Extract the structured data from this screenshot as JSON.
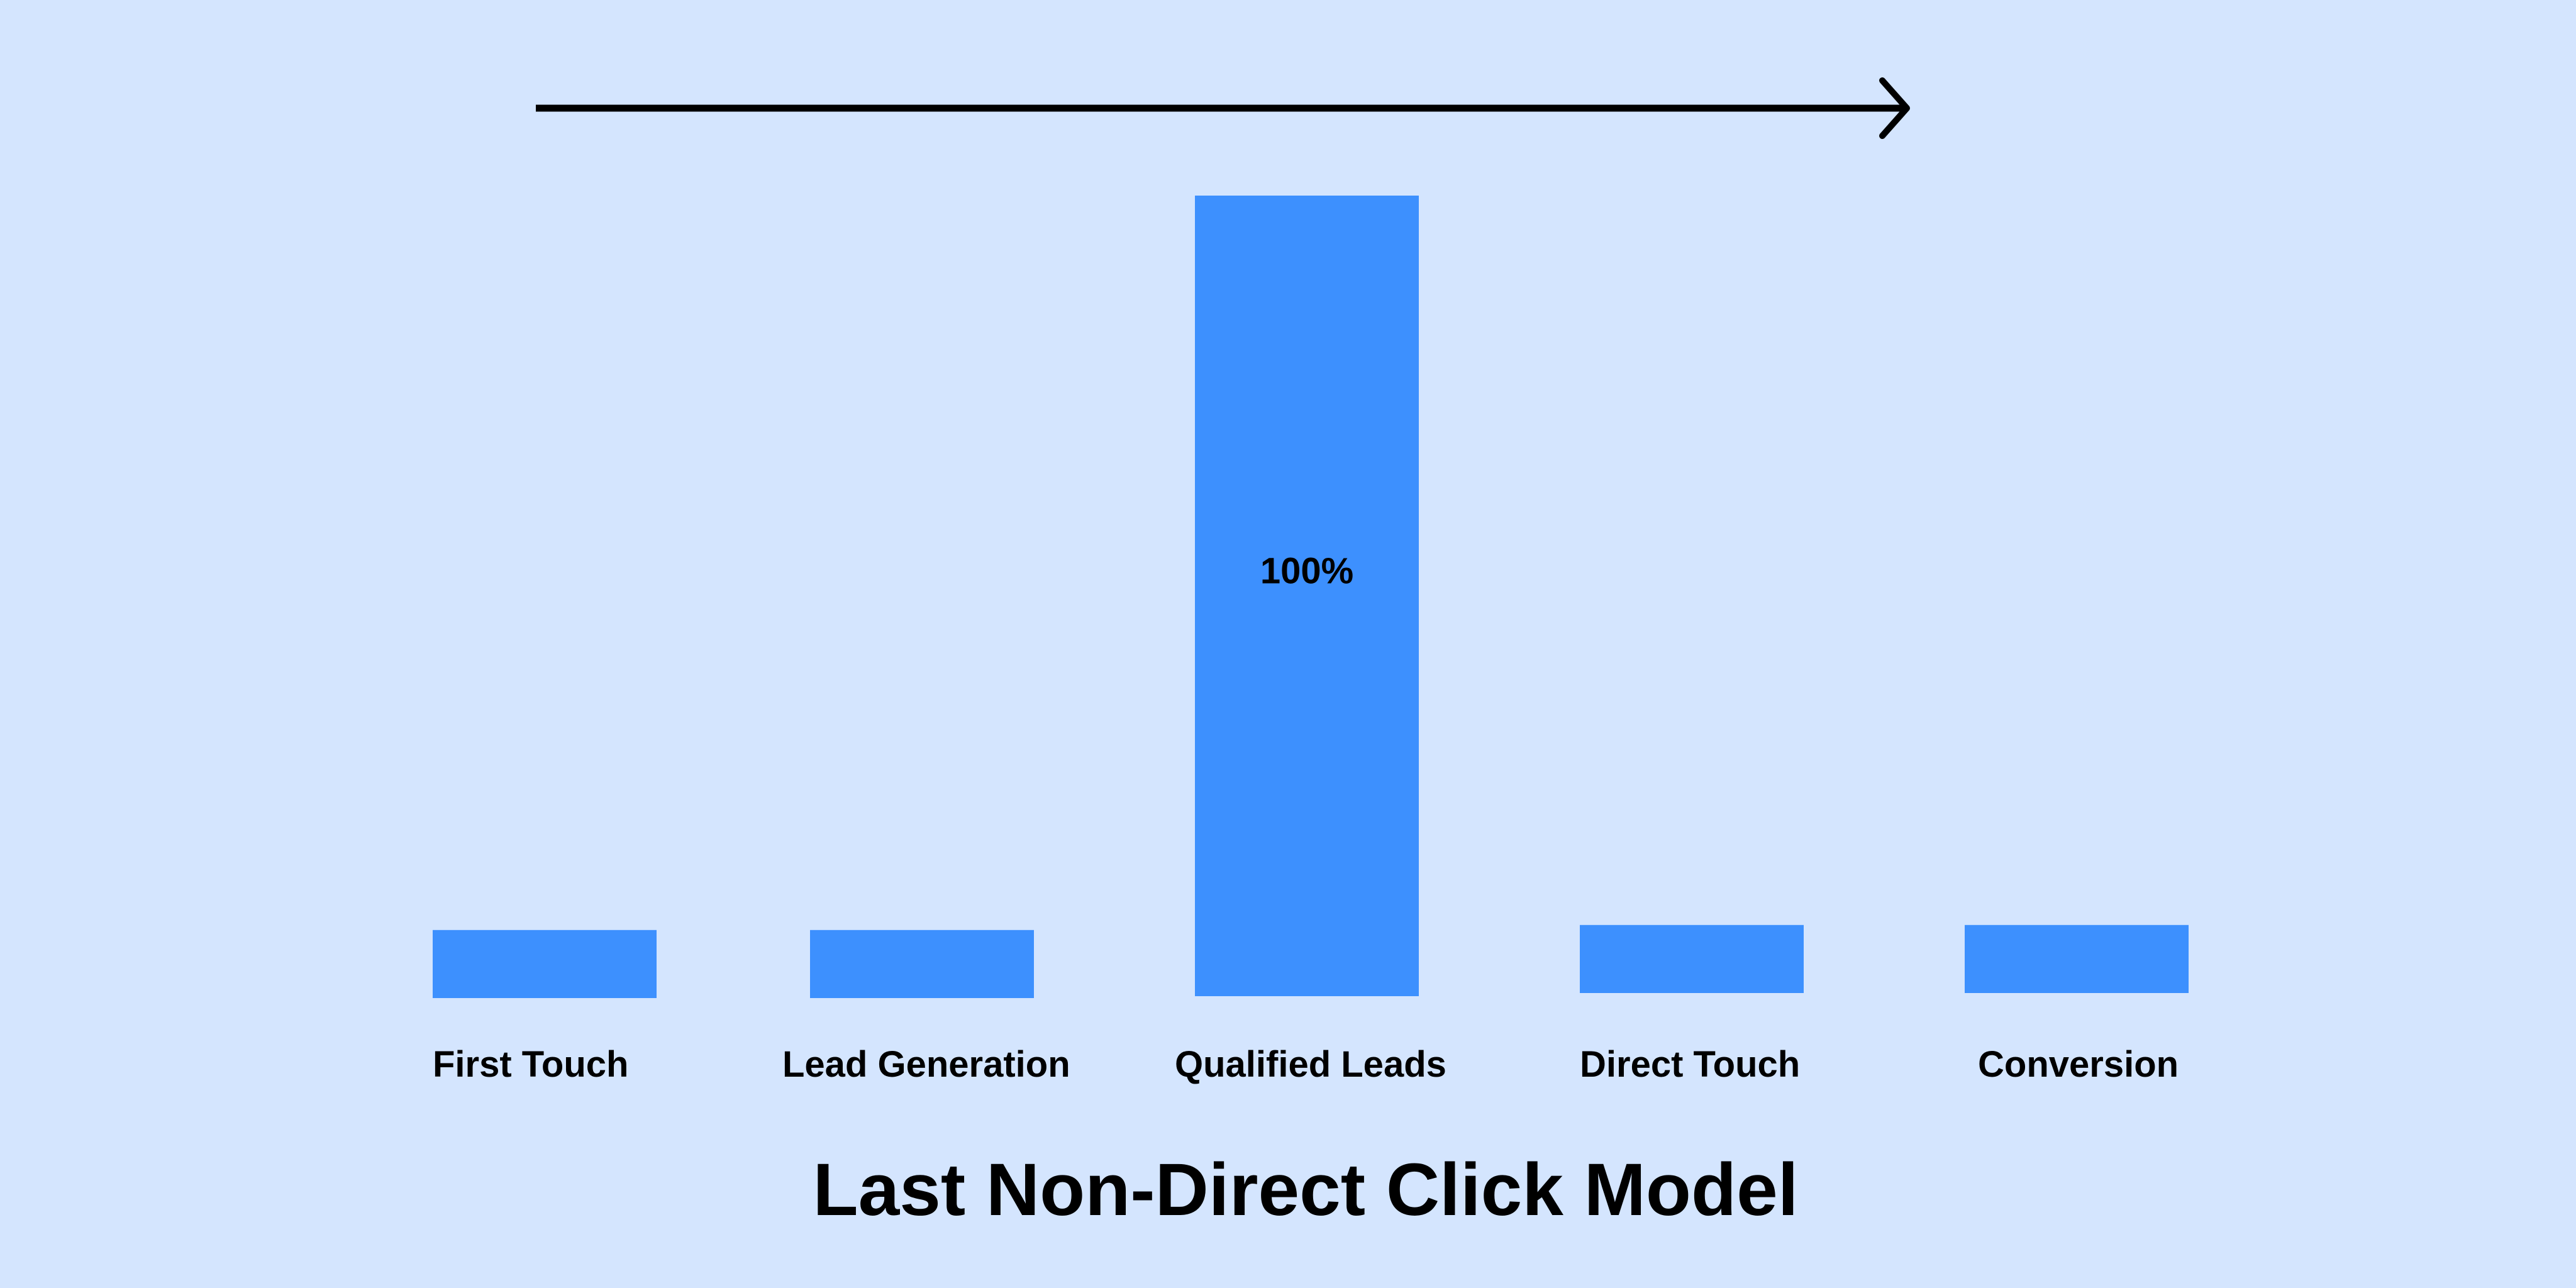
{
  "chart_data": {
    "type": "bar",
    "title": "Last Non-Direct Click Model",
    "xlabel": "",
    "ylabel": "",
    "categories": [
      "First Touch",
      "Lead Generation",
      "Qualified Leads",
      "Direct Touch",
      "Conversion"
    ],
    "values": [
      8.5,
      8.5,
      100,
      8.5,
      8.5
    ],
    "data_labels": [
      "",
      "",
      "100%",
      "",
      ""
    ],
    "ylim": [
      0,
      100
    ],
    "grid": false,
    "legend": "none",
    "annotation": "arrow-right (journey direction)",
    "colors": {
      "background": "#d4e5fe",
      "bar": "#3d90fe",
      "text": "#000000"
    }
  }
}
